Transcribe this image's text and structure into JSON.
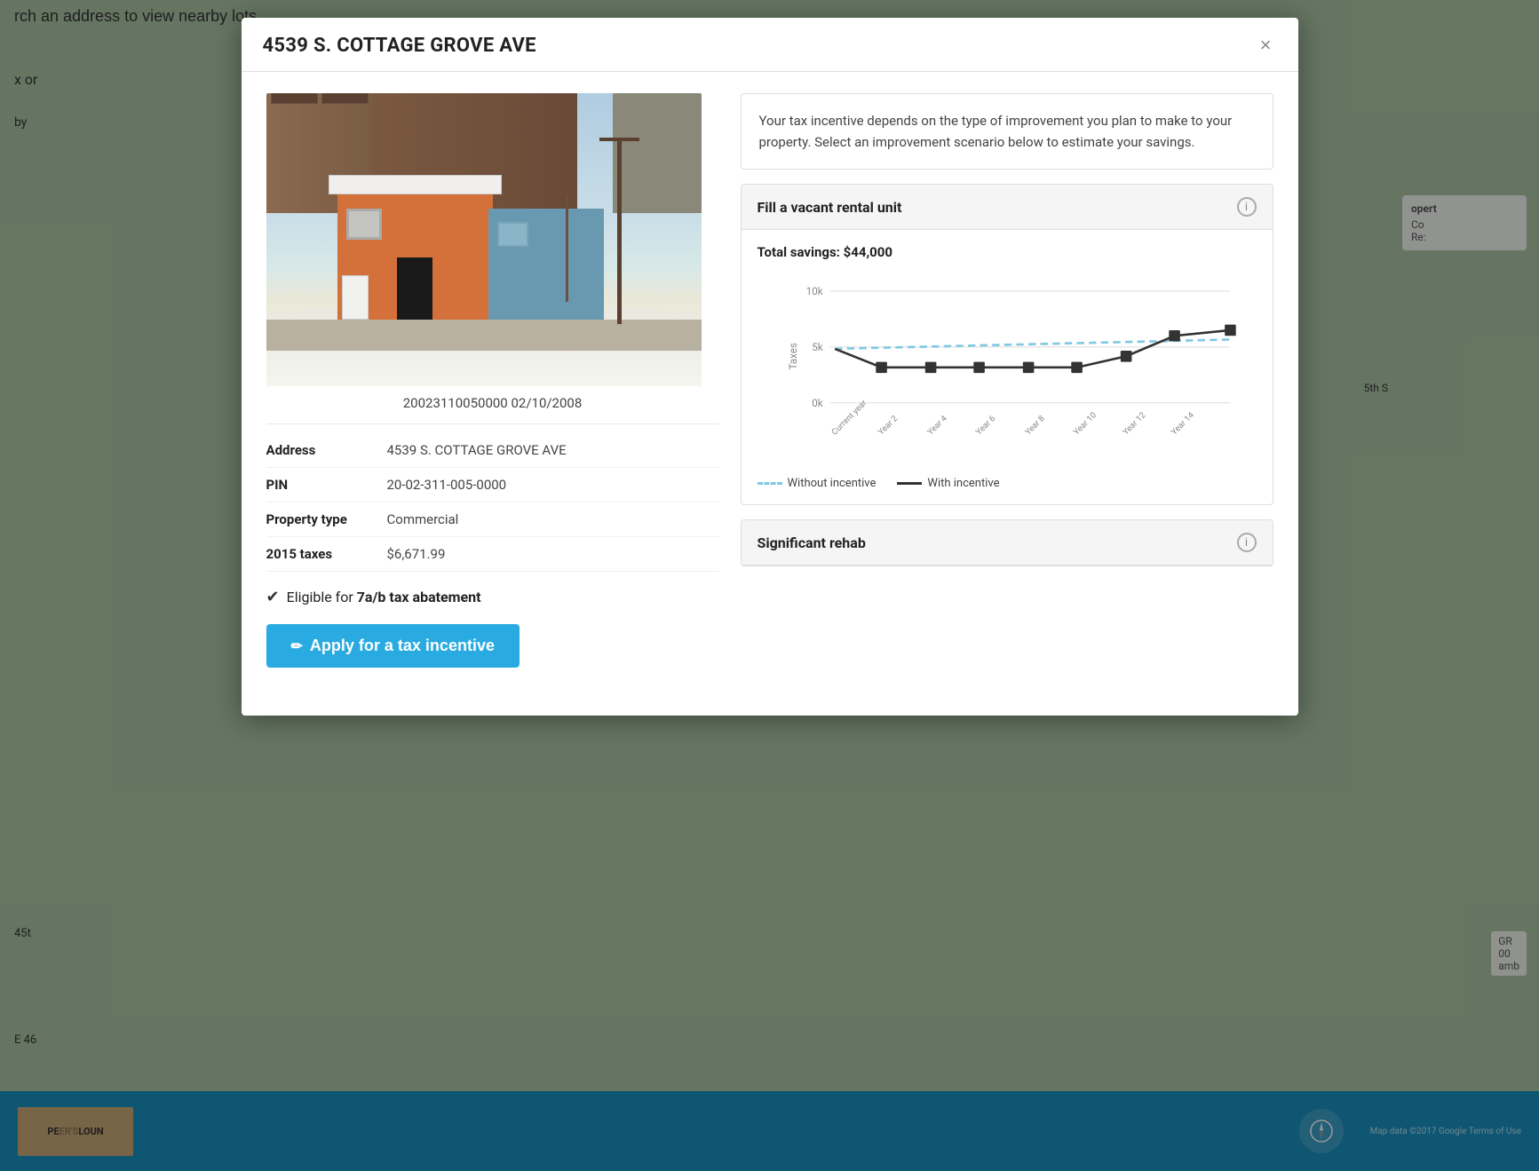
{
  "map": {
    "top_text": "rch an address to view nearby lots",
    "left_text": "x or",
    "by_text": "by"
  },
  "modal": {
    "title": "4539 S. COTTAGE GROVE AVE",
    "close_label": "×",
    "property_meta": "20023110050000  02/10/2008",
    "details": [
      {
        "label": "Address",
        "value": "4539 S. COTTAGE GROVE AVE"
      },
      {
        "label": "PIN",
        "value": "20-02-311-005-0000"
      },
      {
        "label": "Property type",
        "value": "Commercial"
      },
      {
        "label": "2015 taxes",
        "value": "$6,671.99"
      }
    ],
    "eligibility_text": "Eligible for",
    "eligibility_bold": "7a/b tax abatement",
    "apply_button_label": "Apply for a tax incentive",
    "info_text": "Your tax incentive depends on the type of improvement you plan to make to your property. Select an improvement scenario below to estimate your savings.",
    "scenario1": {
      "title": "Fill a vacant rental unit",
      "info_label": "i",
      "total_savings_label": "Total savings:",
      "total_savings_value": "$44,000",
      "chart": {
        "y_labels": [
          "10k",
          "5k",
          "0k"
        ],
        "x_labels": [
          "Current year",
          "Year 2",
          "Year 4",
          "Year 6",
          "Year 8",
          "Year 10",
          "Year 12",
          "Year 14"
        ],
        "y_axis_label": "Taxes",
        "without_incentive_label": "Without incentive",
        "with_incentive_label": "With incentive"
      }
    },
    "scenario2": {
      "title": "Significant rehab",
      "info_label": "i"
    }
  }
}
